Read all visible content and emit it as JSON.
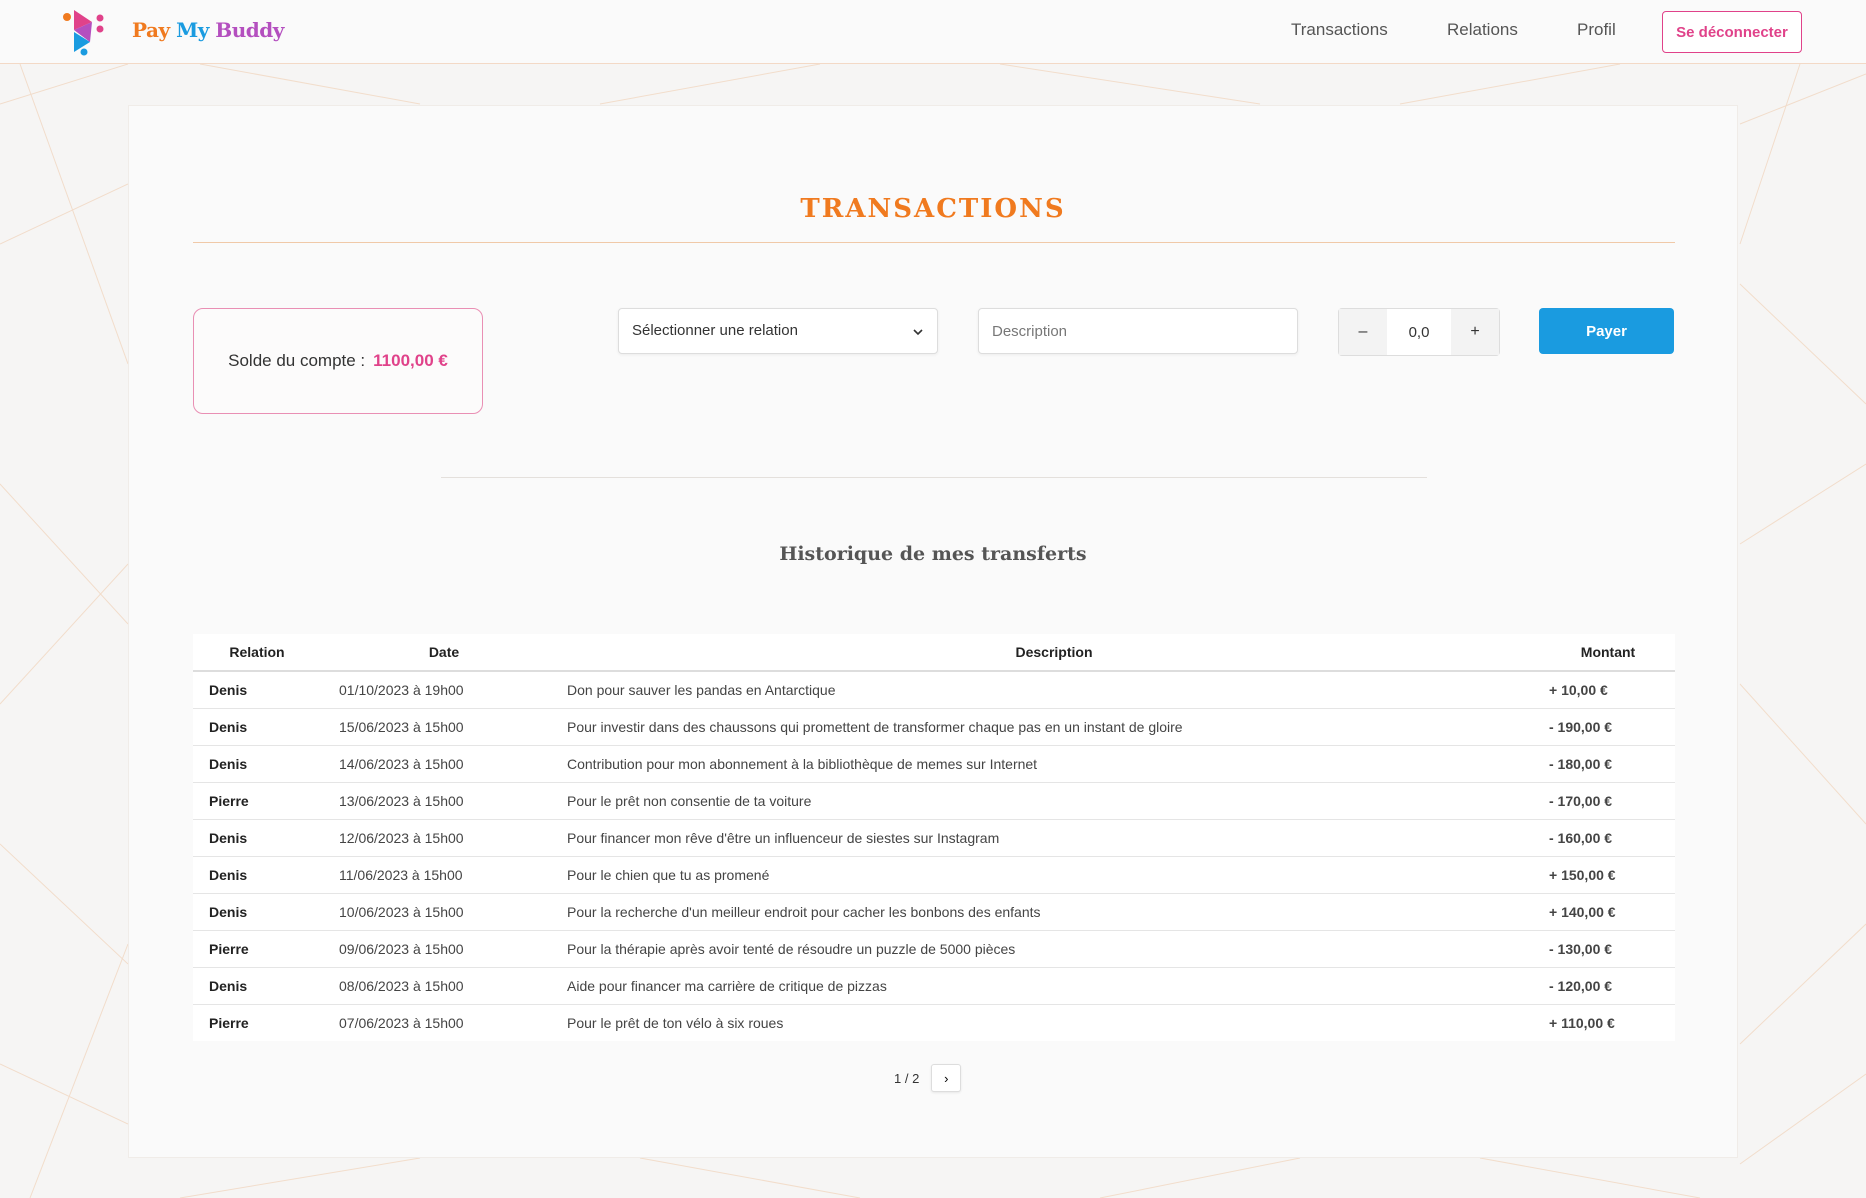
{
  "brand": {
    "name_pay": "Pay",
    "name_my": "My",
    "name_buddy": "Buddy",
    "colors": {
      "pay": "#f07a1f",
      "my": "#1a9be0",
      "buddy": "#b44fbf"
    }
  },
  "nav": {
    "transactions": "Transactions",
    "relations": "Relations",
    "profil": "Profil",
    "logout": "Se déconnecter"
  },
  "page": {
    "title": "TRANSACTIONS",
    "balance_label": "Solde du compte :",
    "balance_value": "1100,00 €"
  },
  "form": {
    "relation_placeholder": "Sélectionner une relation",
    "description_placeholder": "Description",
    "amount_value": "0,0",
    "minus_label": "–",
    "plus_label": "+",
    "pay_label": "Payer"
  },
  "history": {
    "title": "Historique de mes transferts",
    "columns": {
      "relation": "Relation",
      "date": "Date",
      "description": "Description",
      "amount": "Montant"
    },
    "rows": [
      {
        "relation": "Denis",
        "date": "01/10/2023 à 19h00",
        "description": "Don pour sauver les pandas en Antarctique",
        "amount": "+ 10,00 €",
        "type": "pos"
      },
      {
        "relation": "Denis",
        "date": "15/06/2023 à 15h00",
        "description": "Pour investir dans des chaussons qui promettent de transformer chaque pas en un instant de gloire",
        "amount": "- 190,00 €",
        "type": "neg"
      },
      {
        "relation": "Denis",
        "date": "14/06/2023 à 15h00",
        "description": "Contribution pour mon abonnement à la bibliothèque de memes sur Internet",
        "amount": "- 180,00 €",
        "type": "neg"
      },
      {
        "relation": "Pierre",
        "date": "13/06/2023 à 15h00",
        "description": "Pour le prêt non consentie de ta voiture",
        "amount": "- 170,00 €",
        "type": "neg"
      },
      {
        "relation": "Denis",
        "date": "12/06/2023 à 15h00",
        "description": "Pour financer mon rêve d'être un influenceur de siestes sur Instagram",
        "amount": "- 160,00 €",
        "type": "neg"
      },
      {
        "relation": "Denis",
        "date": "11/06/2023 à 15h00",
        "description": "Pour le chien que tu as promené",
        "amount": "+ 150,00 €",
        "type": "pos"
      },
      {
        "relation": "Denis",
        "date": "10/06/2023 à 15h00",
        "description": "Pour la recherche d'un meilleur endroit pour cacher les bonbons des enfants",
        "amount": "+ 140,00 €",
        "type": "pos"
      },
      {
        "relation": "Pierre",
        "date": "09/06/2023 à 15h00",
        "description": "Pour la thérapie après avoir tenté de résoudre un puzzle de 5000 pièces",
        "amount": "- 130,00 €",
        "type": "neg"
      },
      {
        "relation": "Denis",
        "date": "08/06/2023 à 15h00",
        "description": "Aide pour financer ma carrière de critique de pizzas",
        "amount": "- 120,00 €",
        "type": "neg"
      },
      {
        "relation": "Pierre",
        "date": "07/06/2023 à 15h00",
        "description": "Pour le prêt de ton vélo à six roues",
        "amount": "+ 110,00 €",
        "type": "pos"
      }
    ]
  },
  "pagination": {
    "label": "1 / 2",
    "next": "›"
  }
}
